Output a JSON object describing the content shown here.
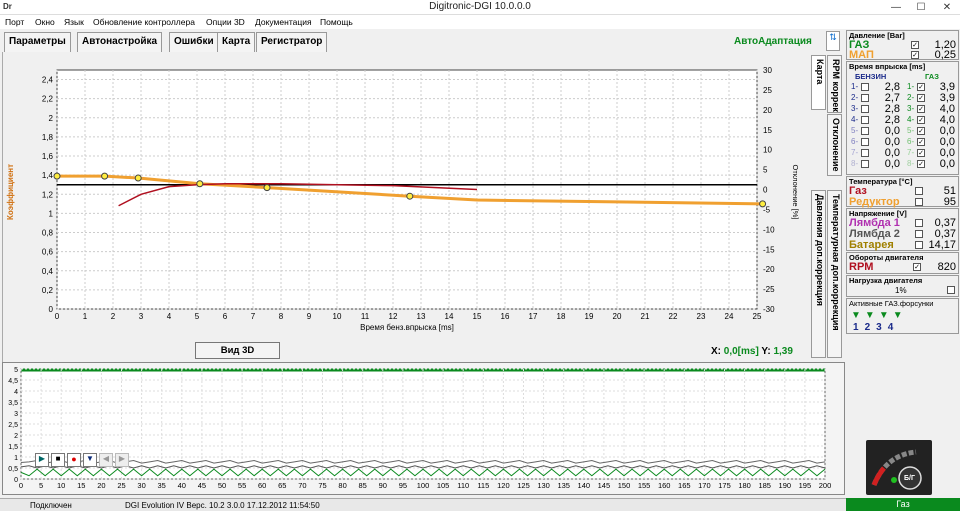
{
  "window": {
    "title": "Digitronic-DGI  10.0.0.0",
    "logo": "Dr",
    "controls": [
      "—",
      "☐",
      "✕"
    ]
  },
  "menu": [
    "Порт",
    "Окно",
    "Язык",
    "Обновление контроллера",
    "Опции 3D",
    "Документация",
    "Помощь"
  ],
  "tabs": [
    "Параметры",
    "Автонастройка",
    "Ошибки",
    "Карта",
    "Регистратор"
  ],
  "autoadapt": "АвтоАдаптация",
  "vtabs": [
    "Карта",
    "RPM коррекция",
    "Отклонение",
    "Давления доп.коррекция",
    "Температурная доп.коррекция"
  ],
  "chart_data": {
    "type": "line",
    "ylabel": "Коэффициент",
    "ylabel2": "Отклонение [%]",
    "xlabel": "Время бенз.впрыска [ms]",
    "xlim": [
      0,
      25
    ],
    "ylim": [
      0,
      2.5
    ],
    "y2lim": [
      -30,
      30
    ],
    "x_ticks": [
      0,
      1,
      2,
      3,
      4,
      5,
      6,
      7,
      8,
      9,
      10,
      11,
      12,
      13,
      14,
      15,
      16,
      17,
      18,
      19,
      20,
      21,
      22,
      23,
      24,
      25
    ],
    "y_ticks": [
      "0",
      "0,2",
      "0,4",
      "0,6",
      "0,8",
      "1",
      "1,2",
      "1,4",
      "1,6",
      "1,8",
      "2",
      "2,2",
      "2,4"
    ],
    "y2_ticks": [
      30,
      25,
      20,
      15,
      10,
      5,
      0,
      -5,
      -10,
      -15,
      -20,
      -25,
      -30
    ],
    "series": [
      {
        "color": "#f0a030",
        "x": [
          0,
          1.7,
          2.9,
          5.1,
          7.5,
          12.6,
          15,
          20,
          25.2
        ],
        "y": [
          1.39,
          1.39,
          1.37,
          1.31,
          1.27,
          1.18,
          1.14,
          1.12,
          1.1
        ]
      },
      {
        "color": "#b01020",
        "x": [
          2.2,
          3,
          4,
          5,
          6,
          8,
          10,
          12,
          15
        ],
        "y": [
          1.08,
          1.2,
          1.28,
          1.3,
          1.31,
          1.31,
          1.3,
          1.29,
          1.25
        ]
      }
    ],
    "markers": {
      "x": [
        0,
        1.7,
        2.9,
        5.1,
        7.5,
        12.6,
        25.2
      ],
      "y": [
        1.39,
        1.39,
        1.37,
        1.31,
        1.27,
        1.18,
        1.1
      ]
    },
    "reference_y": 1.3
  },
  "view3d": "Вид 3D",
  "xy": {
    "x_label": "X:",
    "x_val": "0,0[ms]",
    "y_label": "Y:",
    "y_val": "1,39"
  },
  "recorder": {
    "y_ticks": [
      "5",
      "4,5",
      "4",
      "3,5",
      "3",
      "2,5",
      "2",
      "1,5",
      "1",
      "0,5",
      "0"
    ],
    "x_ticks": [
      0,
      5,
      10,
      15,
      20,
      25,
      30,
      35,
      40,
      45,
      50,
      55,
      60,
      65,
      70,
      75,
      80,
      85,
      90,
      95,
      100,
      105,
      110,
      115,
      120,
      125,
      130,
      135,
      140,
      145,
      150,
      155,
      160,
      165,
      170,
      175,
      180,
      185,
      190,
      195,
      200
    ],
    "controls": [
      "▶",
      "■",
      "●",
      "▼",
      "◀",
      "▶"
    ]
  },
  "status": {
    "conn": "Подключен",
    "info": "DGI Evolution IV   Верс. 10.2  3.0.0   17.12.2012 11:54:50",
    "fuel": "Газ"
  },
  "pressure": {
    "title": "Давление [Bar]",
    "gas_label": "ГАЗ",
    "gas_val": "1,20",
    "map_label": "МАП",
    "map_val": "0,25"
  },
  "injection": {
    "title": "Время впрыска [ms]",
    "benzin": "БЕНЗИН",
    "gaz": "ГАЗ",
    "petrol": [
      "2,8",
      "2,7",
      "2,8",
      "2,8",
      "0,0",
      "0,0",
      "0,0",
      "0,0"
    ],
    "gas": [
      "3,9",
      "3,9",
      "4,0",
      "4,0",
      "0,0",
      "0,0",
      "0,0",
      "0,0"
    ]
  },
  "temp": {
    "title": "Температура  [°C]",
    "gas_label": "Газ",
    "gas_val": "51",
    "red_label": "Редуктор",
    "red_val": "95"
  },
  "voltage": {
    "title": "Напряжение [V]",
    "l1_label": "Лямбда 1",
    "l1_val": "0,37",
    "l2_label": "Лямбда 2",
    "l2_val": "0,37",
    "bat_label": "Батарея",
    "bat_val": "14,17"
  },
  "rpm": {
    "title": "Обороты двигателя",
    "label": "RPM",
    "val": "820"
  },
  "load": {
    "title": "Нагрузка двигателя",
    "val": "1%"
  },
  "injectors": {
    "title": "Активные ГАЗ.форсунки",
    "labels": [
      "1",
      "2",
      "3",
      "4"
    ]
  },
  "logo_text": "Б/Г",
  "colors": {
    "green": "#0a8a1e",
    "orange": "#f0a030",
    "red": "#b01020",
    "purple": "#b030b0"
  }
}
